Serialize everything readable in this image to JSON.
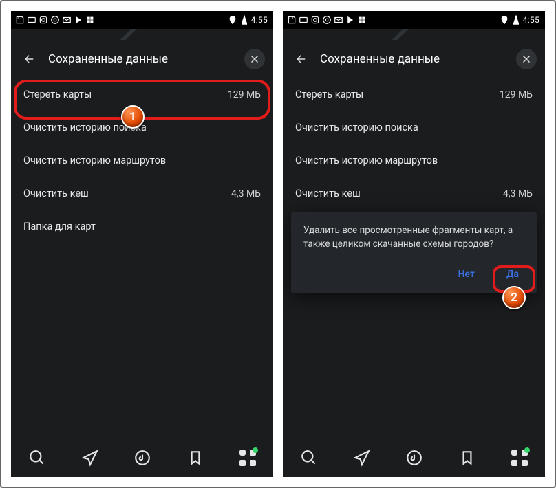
{
  "statusbar": {
    "time": "4:55"
  },
  "header": {
    "title": "Сохраненные данные"
  },
  "rows": {
    "erase_maps": {
      "label": "Стереть карты",
      "value": "129 МБ"
    },
    "clear_search": {
      "label": "Очистить историю поиска"
    },
    "clear_routes": {
      "label": "Очистить историю маршрутов"
    },
    "clear_cache": {
      "label": "Очистить кеш",
      "value": "4,3 МБ"
    },
    "maps_folder": {
      "label": "Папка для карт"
    }
  },
  "dialog": {
    "message": "Удалить все просмотренные фрагменты карт, а также целиком скачанные схемы городов?",
    "no": "Нет",
    "yes": "Да"
  },
  "badges": {
    "one": "1",
    "two": "2"
  }
}
